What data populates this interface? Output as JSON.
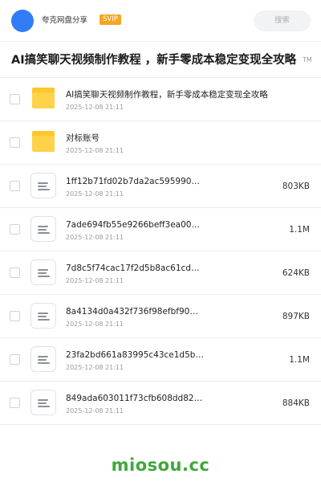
{
  "header": {
    "share_name": "夸克网盘分享",
    "badge": "SVIP",
    "search_placeholder": "搜索"
  },
  "title": {
    "text": "AI搞笑聊天视频制作教程 ，新手零成本稳定变现全攻略",
    "suffix": "TM"
  },
  "items": [
    {
      "type": "folder",
      "name": "AI搞笑聊天视频制作教程，新手零成本稳定变现全攻略",
      "date": "2025-12-08 21:11",
      "size": ""
    },
    {
      "type": "folder",
      "name": "对标账号",
      "date": "2025-12-08 21:11",
      "size": ""
    },
    {
      "type": "file",
      "name": "1ff12b71fd02b7da2ac595990…",
      "date": "2025-12-08 21:11",
      "size": "803KB"
    },
    {
      "type": "file",
      "name": "7ade694fb55e9266beff3ea00…",
      "date": "2025-12-08 21:11",
      "size": "1.1M"
    },
    {
      "type": "file",
      "name": "7d8c5f74cac17f2d5b8ac61cd…",
      "date": "2025-12-08 21:11",
      "size": "624KB"
    },
    {
      "type": "file",
      "name": "8a4134d0a432f736f98efbf90…",
      "date": "2025-12-08 21:11",
      "size": "897KB"
    },
    {
      "type": "file",
      "name": "23fa2bd661a83995c43ce1d5b…",
      "date": "2025-12-08 21:11",
      "size": "1.1M"
    },
    {
      "type": "file",
      "name": "849ada603011f73cfb608dd82…",
      "date": "2025-12-08 21:11",
      "size": "884KB"
    }
  ],
  "watermark": "miosou.cc",
  "colors": {
    "avatar": "#2f7cf6",
    "svip_badge": "#f5a623",
    "folder": "#ffd24a",
    "watermark": "#3fa83a"
  }
}
